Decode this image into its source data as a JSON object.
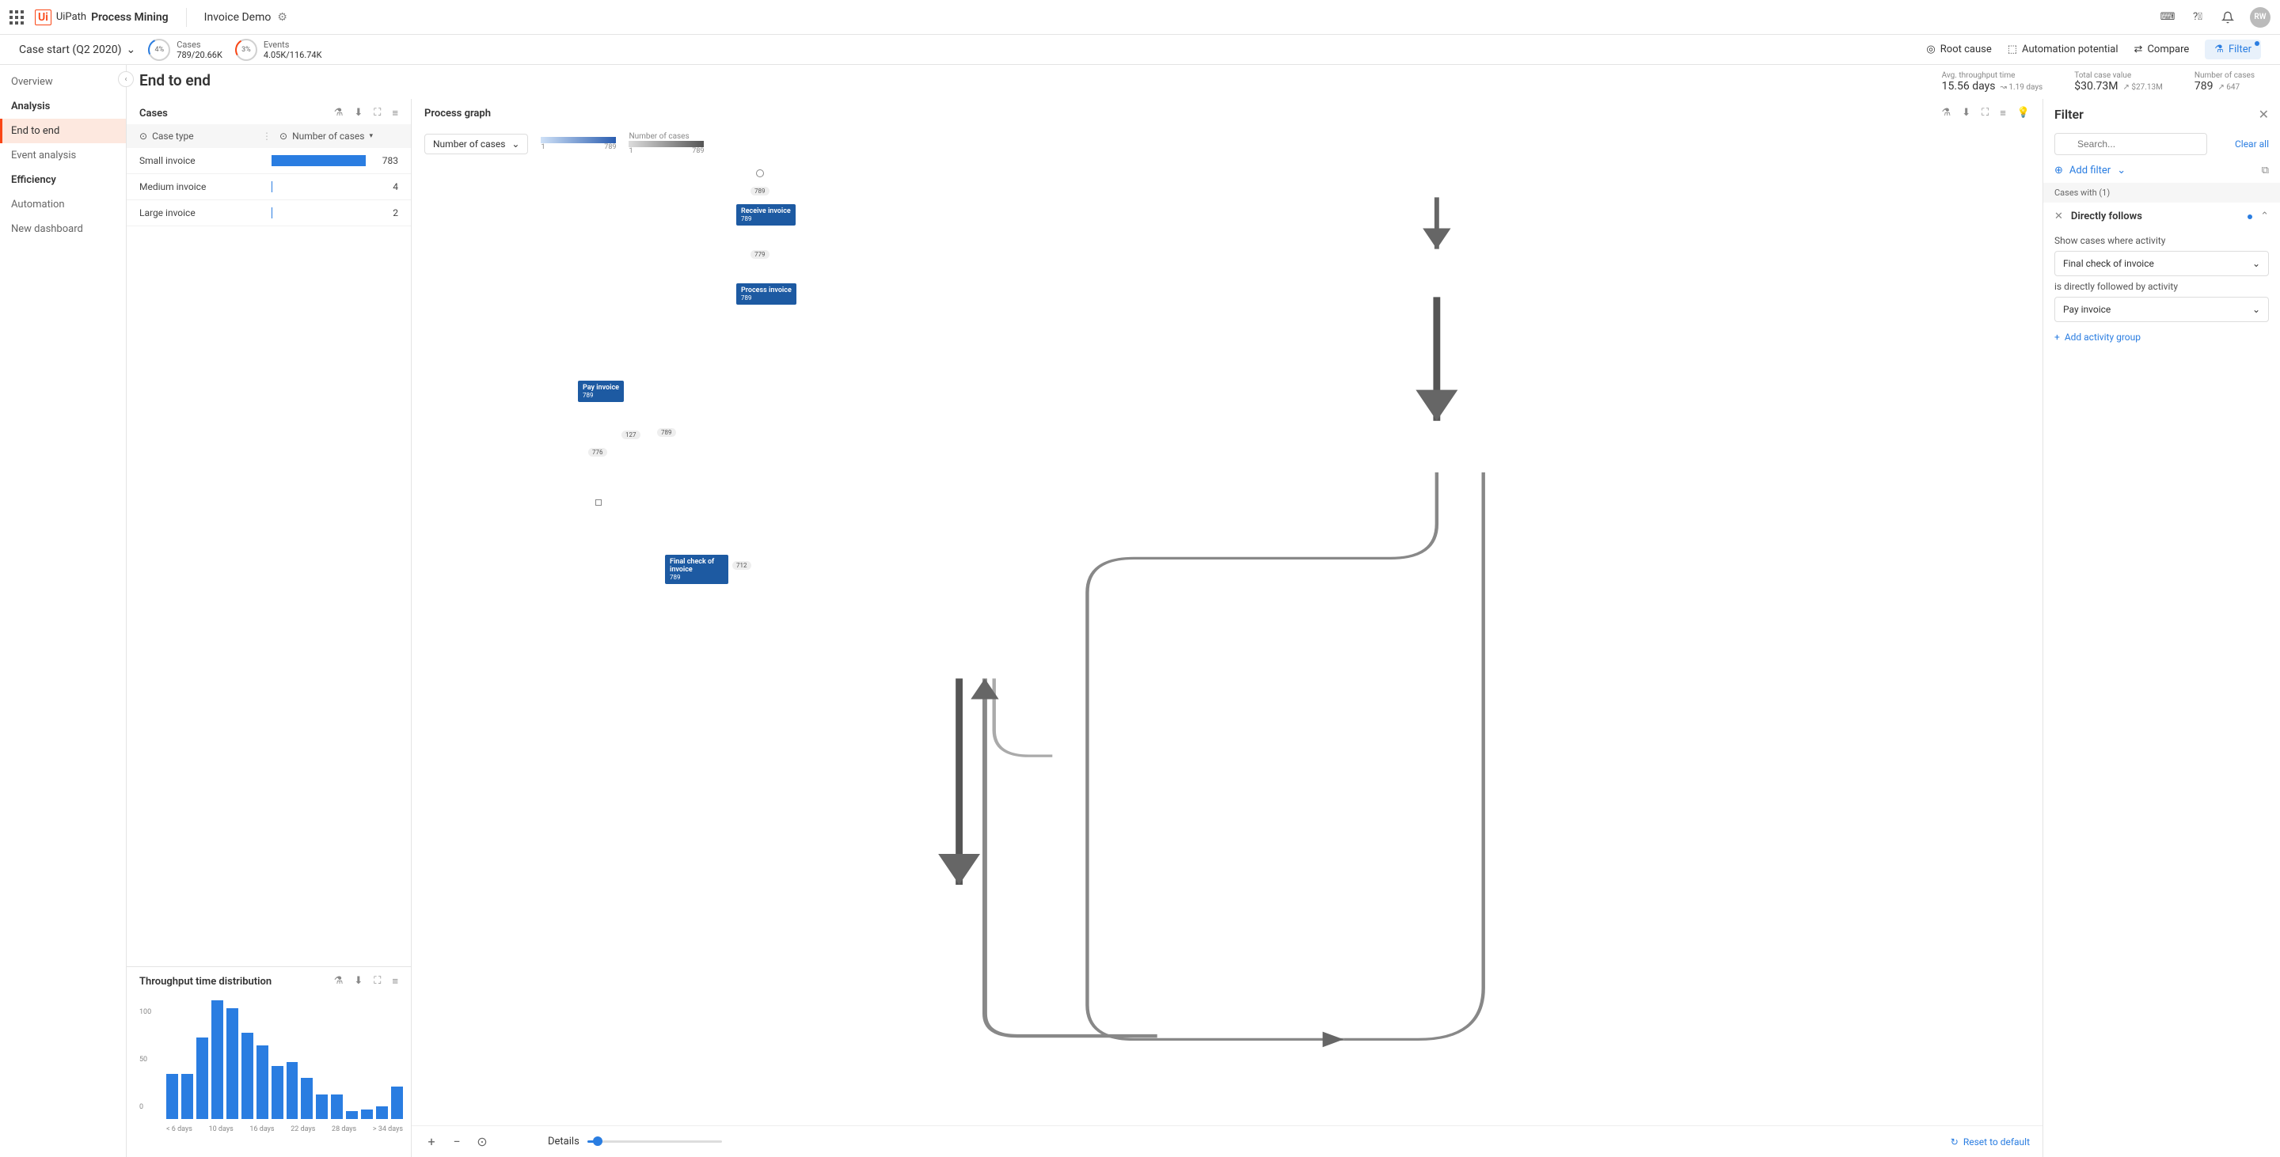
{
  "header": {
    "logo_brand": "UiPath",
    "logo_product": "Process Mining",
    "project": "Invoice Demo",
    "avatar": "RW"
  },
  "subbar": {
    "scope": "Case start (Q2 2020)",
    "cases_chip_pct": "4%",
    "cases_chip_label": "Cases",
    "cases_chip_value": "789/20.66K",
    "events_chip_pct": "3%",
    "events_chip_label": "Events",
    "events_chip_value": "4.05K/116.74K",
    "root_cause": "Root cause",
    "automation": "Automation potential",
    "compare": "Compare",
    "filter": "Filter"
  },
  "nav": {
    "overview": "Overview",
    "analysis": "Analysis",
    "end_to_end": "End to end",
    "event_analysis": "Event analysis",
    "efficiency": "Efficiency",
    "automation": "Automation",
    "new_dashboard": "New dashboard"
  },
  "page": {
    "title": "End to end",
    "kpi1_label": "Avg. throughput time",
    "kpi1_value": "15.56 days",
    "kpi1_trend": "1.19 days",
    "kpi2_label": "Total case value",
    "kpi2_value": "$30.73M",
    "kpi2_trend": "$27.13M",
    "kpi3_label": "Number of cases",
    "kpi3_value": "789",
    "kpi3_trend": "647"
  },
  "cases_panel": {
    "title": "Cases",
    "col1": "Case type",
    "col2": "Number of cases",
    "rows": [
      {
        "name": "Small invoice",
        "value": 783,
        "pct": 99
      },
      {
        "name": "Medium invoice",
        "value": 4,
        "pct": 1
      },
      {
        "name": "Large invoice",
        "value": 2,
        "pct": 1
      }
    ]
  },
  "dist_panel": {
    "title": "Throughput time distribution"
  },
  "chart_data": {
    "type": "bar",
    "title": "Throughput time distribution",
    "xlabel": "",
    "ylabel": "",
    "ylim": [
      0,
      150
    ],
    "yticks": [
      0,
      50,
      100
    ],
    "categories": [
      "< 6 days",
      "",
      "",
      "10 days",
      "",
      "",
      "16 days",
      "",
      "",
      "22 days",
      "",
      "",
      "28 days",
      "",
      "",
      "> 34 days"
    ],
    "values": [
      55,
      55,
      100,
      145,
      135,
      105,
      90,
      65,
      70,
      50,
      30,
      30,
      10,
      12,
      15,
      40
    ],
    "xticks_display": [
      "< 6 days",
      "10 days",
      "16 days",
      "22 days",
      "28 days",
      "> 34 days"
    ]
  },
  "graph_panel": {
    "title": "Process graph",
    "metric_select": "Number of cases",
    "legend1_title": "",
    "legend1_min": "1",
    "legend1_max": "789",
    "legend2_title": "Number of cases",
    "legend2_min": "1",
    "legend2_max": "789",
    "nodes": {
      "receive": {
        "name": "Receive invoice",
        "val": "789"
      },
      "process": {
        "name": "Process invoice",
        "val": "789"
      },
      "pay": {
        "name": "Pay invoice",
        "val": "789"
      },
      "final": {
        "name": "Final check of invoice",
        "val": "789"
      }
    },
    "edges": {
      "start_receive": "789",
      "receive_process": "779",
      "process_pay": "789",
      "pay_final": "712",
      "final_pay": "776",
      "side": "127"
    },
    "details_label": "Details",
    "reset": "Reset to default"
  },
  "filter_panel": {
    "title": "Filter",
    "search_placeholder": "Search...",
    "clear_all": "Clear all",
    "add_filter": "Add filter",
    "section": "Cases with (1)",
    "item_name": "Directly follows",
    "body_label1": "Show cases where activity",
    "select1": "Final check of invoice",
    "body_label2": "is directly followed by activity",
    "select2": "Pay invoice",
    "add_group": "Add activity group"
  }
}
